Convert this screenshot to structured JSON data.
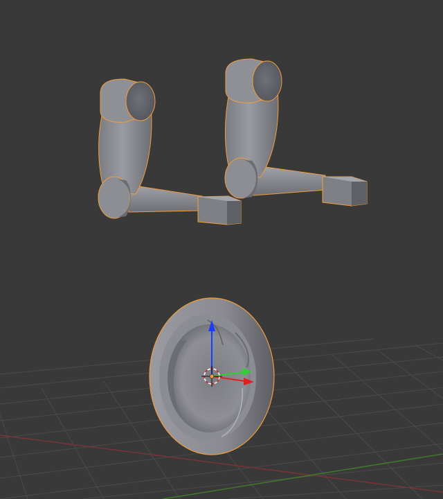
{
  "viewport": {
    "view": "perspective",
    "background_color": "#393939",
    "grid_color": "#4a4a4a",
    "x_axis_color": "#7a3434",
    "y_axis_color": "#3f7a2b",
    "selection_outline_color": "#f09d3c"
  },
  "objects": [
    {
      "name": "suspension-arm-left",
      "selected": true,
      "color": "#8b8c93"
    },
    {
      "name": "suspension-arm-right",
      "selected": true,
      "color": "#8b8c93"
    },
    {
      "name": "wheel",
      "selected": true,
      "color": "#8b8c93"
    }
  ],
  "gizmo": {
    "type": "translate",
    "z_color": "#1a3cff",
    "y_color": "#2fd12f",
    "x_color": "#e02020",
    "cursor_color": "#ffffff",
    "origin_color": "#f09d3c"
  }
}
